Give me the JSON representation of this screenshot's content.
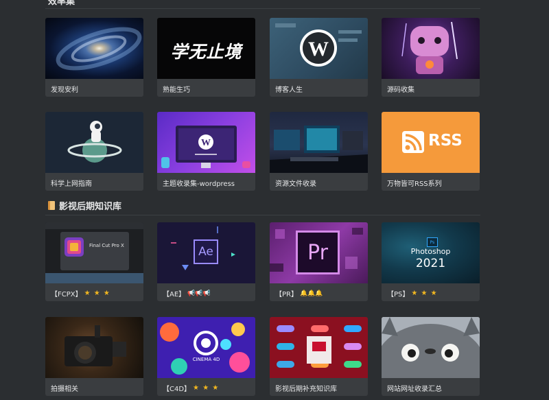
{
  "section1": {
    "title": "效率集"
  },
  "section2": {
    "title": "影视后期知识库",
    "icon": "book-icon"
  },
  "cards_row1": [
    {
      "label": "发现安利"
    },
    {
      "label": "熟能生巧"
    },
    {
      "label": "博客人生"
    },
    {
      "label": "源码收集"
    }
  ],
  "cards_row2": [
    {
      "label": "科学上网指南"
    },
    {
      "label": "主题收录集-wordpress"
    },
    {
      "label": "资源文件收录"
    },
    {
      "label": "万物皆可RSS系列"
    }
  ],
  "cards_row3": [
    {
      "label": "【FCPX】",
      "rating": "★ ★ ★"
    },
    {
      "label": "【AE】",
      "rating": "📢📢📢"
    },
    {
      "label": "【PR】",
      "rating": "🔔🔔🔔"
    },
    {
      "label": "【PS】",
      "rating": "★ ★ ★"
    }
  ],
  "cards_row4": [
    {
      "label": "拍摄相关"
    },
    {
      "label": "【C4D】",
      "rating": "★ ★ ★"
    },
    {
      "label": "影视后期补充知识库"
    },
    {
      "label": "网站网址收录汇总"
    }
  ],
  "thumb_text": {
    "xuewuzhijing": "学无止境",
    "rss": "RSS",
    "ae": "Ae",
    "pr": "Pr",
    "ps_title": "Photoshop",
    "ps_year": "2021",
    "ps_badge": "Ps",
    "fcpx": "Final Cut Pro X",
    "c4d": "CINEMA 4D"
  }
}
